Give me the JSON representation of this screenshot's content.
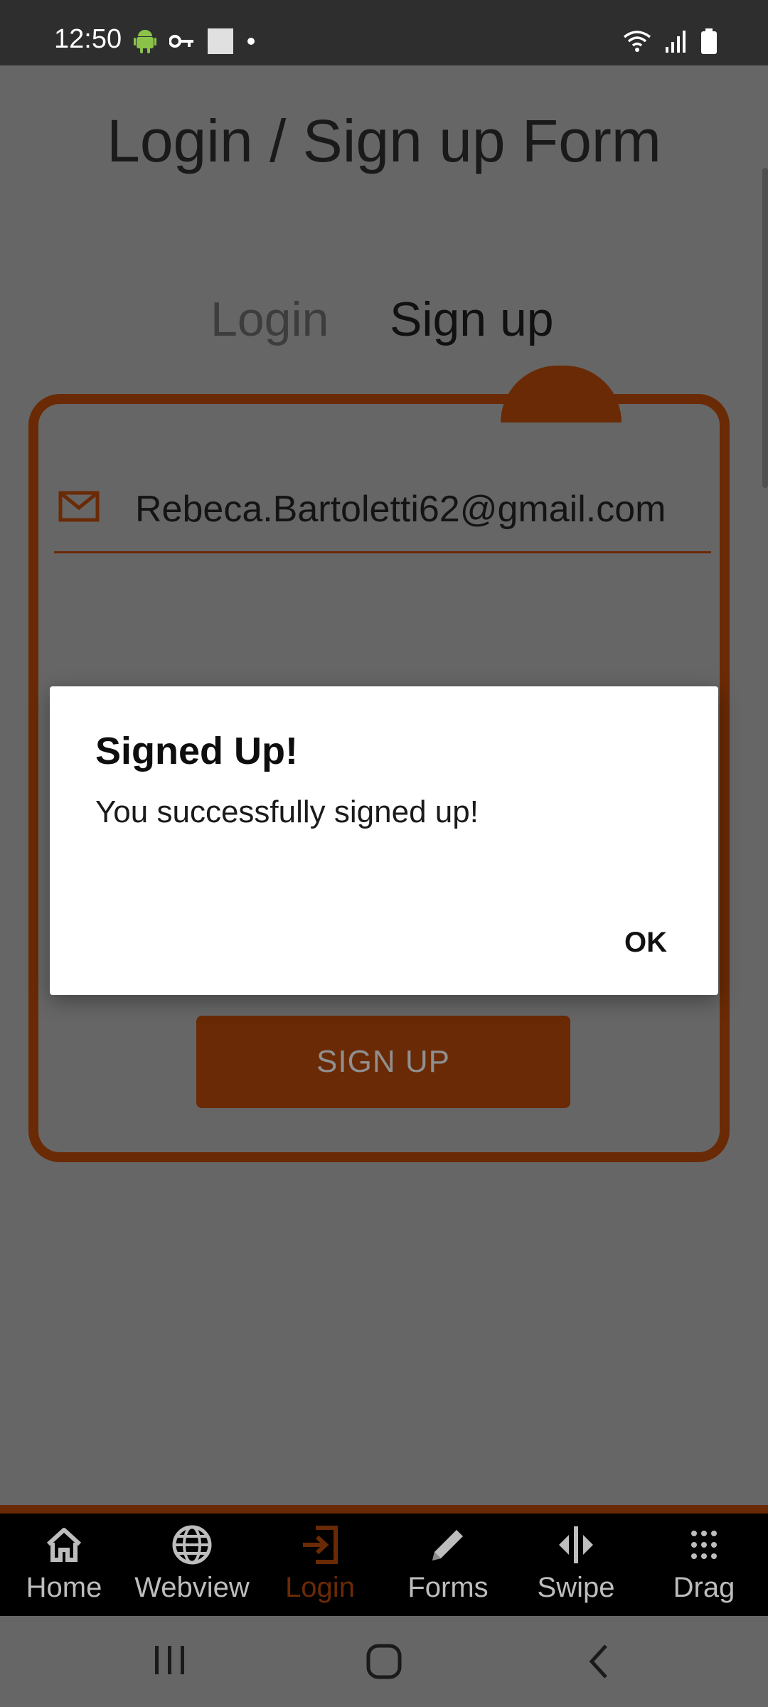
{
  "status_bar": {
    "time": "12:50",
    "left_icons": [
      "android-icon",
      "key-icon",
      "square-icon",
      "dot-icon"
    ],
    "right_icons": [
      "wifi-icon",
      "signal-icon",
      "battery-icon"
    ]
  },
  "page": {
    "title": "Login / Sign up Form",
    "tabs": [
      {
        "label": "Login",
        "active": false
      },
      {
        "label": "Sign up",
        "active": true
      }
    ]
  },
  "form": {
    "email_value": "Rebeca.Bartoletti62@gmail.com",
    "signup_button": "SIGN UP"
  },
  "dialog": {
    "title": "Signed Up!",
    "message": "You successfully signed up!",
    "ok_label": "OK"
  },
  "bottom_nav": {
    "items": [
      {
        "label": "Home",
        "icon": "home-icon"
      },
      {
        "label": "Webview",
        "icon": "globe-icon"
      },
      {
        "label": "Login",
        "icon": "login-icon",
        "active": true
      },
      {
        "label": "Forms",
        "icon": "pencil-icon"
      },
      {
        "label": "Swipe",
        "icon": "swipe-icon"
      },
      {
        "label": "Drag",
        "icon": "drag-icon"
      }
    ]
  },
  "colors": {
    "accent": "#6a2a05",
    "overlay_background": "#666666",
    "nav_background": "#000000"
  }
}
